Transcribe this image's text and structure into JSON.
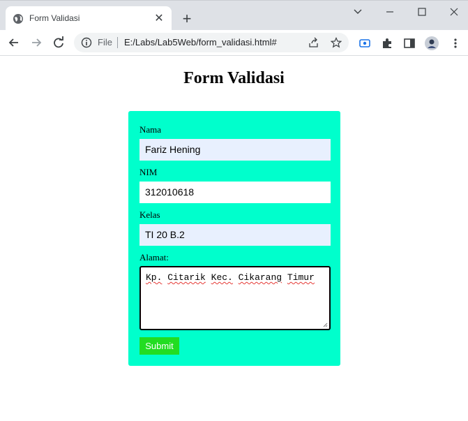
{
  "browser": {
    "tab": {
      "title": "Form Validasi",
      "favicon": "globe-icon",
      "close": "close-icon"
    },
    "new_tab": "plus-icon",
    "address": {
      "scheme": "File",
      "url": "E:/Labs/Lab5Web/form_validasi.html#"
    }
  },
  "page": {
    "title": "Form Validasi",
    "form": {
      "nama_label": "Nama",
      "nama_value": "Fariz Hening",
      "nim_label": "NIM",
      "nim_value": "312010618",
      "kelas_label": "Kelas",
      "kelas_value": "TI 20 B.2",
      "alamat_label": "Alamat:",
      "alamat_words": [
        "Kp.",
        "Citarik",
        "Kec.",
        "Cikarang",
        "Timur"
      ],
      "submit_label": "Submit"
    }
  },
  "colors": {
    "form_bg": "#00ffcc",
    "submit_bg": "#22dd22",
    "autofill_bg": "#e8f0fe"
  }
}
